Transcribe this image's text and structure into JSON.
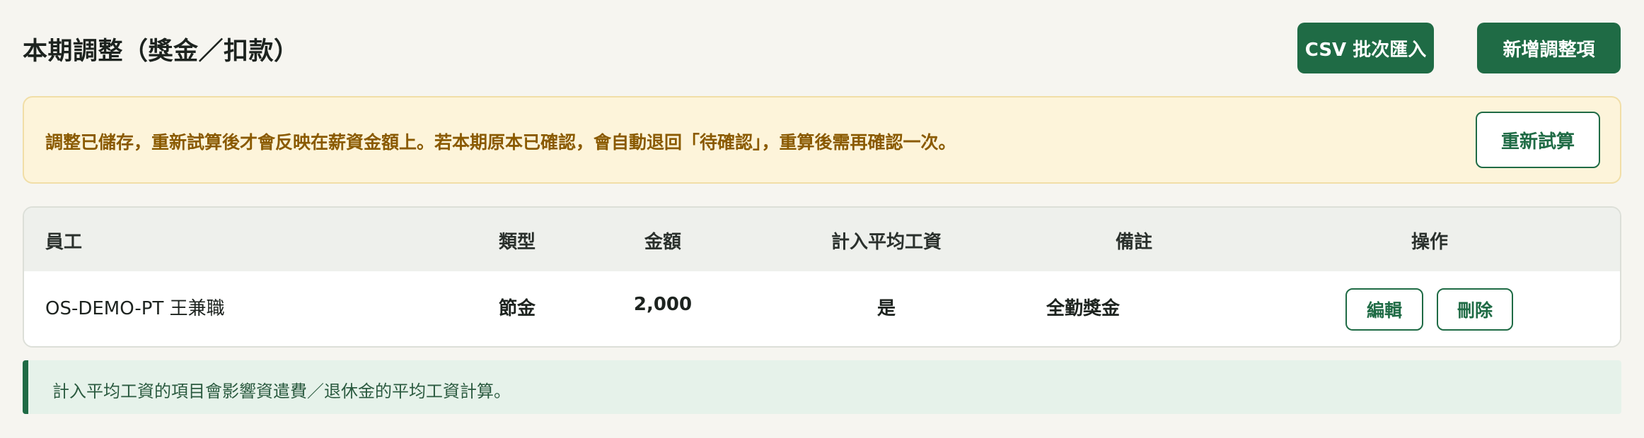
{
  "header": {
    "title": "本期調整（獎金／扣款）",
    "csv_import_label": "CSV 批次匯入",
    "add_adjustment_label": "新增調整項"
  },
  "notice": {
    "message": "調整已儲存，重新試算後才會反映在薪資金額上。若本期原本已確認，會自動退回「待確認」，重算後需再確認一次。",
    "recalculate_label": "重新試算"
  },
  "table": {
    "columns": {
      "employee": "員工",
      "type": "類型",
      "amount": "金額",
      "in_avg_wage": "計入平均工資",
      "note": "備註",
      "actions": "操作"
    },
    "rows": [
      {
        "employee": "OS-DEMO-PT 王兼職",
        "type": "節金",
        "amount": "2,000",
        "in_avg_wage": "是",
        "note": "全勤獎金",
        "edit_label": "編輯",
        "delete_label": "刪除"
      }
    ]
  },
  "info": {
    "message": "計入平均工資的項目會影響資遣費／退休金的平均工資計算。"
  },
  "colors": {
    "primary": "#1f6b45",
    "notice_bg": "#fdf4da",
    "notice_text": "#8a5a00",
    "info_bg": "#e6f2ea"
  }
}
